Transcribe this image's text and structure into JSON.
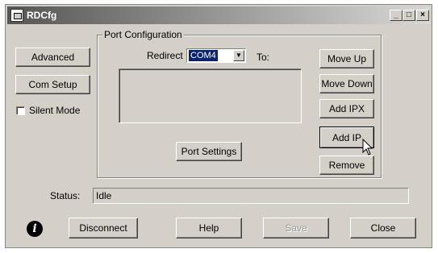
{
  "window": {
    "title": "RDCfg",
    "minimize": "_",
    "maximize": "□",
    "close": "×"
  },
  "left_panel": {
    "advanced_label": "Advanced",
    "com_setup_label": "Com Setup",
    "silent_mode_label": "Silent Mode"
  },
  "port_config": {
    "group_label": "Port Configuration",
    "redirect_label": "Redirect",
    "redirect_value": "COM4",
    "to_label": "To:",
    "port_settings_label": "Port Settings"
  },
  "right_buttons": {
    "move_up": "Move Up",
    "move_down": "Move Down",
    "add_ipx": "Add IPX",
    "add_ip": "Add IP",
    "remove": "Remove"
  },
  "status": {
    "label": "Status:",
    "value": "Idle"
  },
  "bottom_buttons": {
    "disconnect": "Disconnect",
    "help": "Help",
    "save": "Save",
    "close": "Close"
  },
  "icons": {
    "app": "app-icon",
    "info": "info-icon",
    "dropdown": "chevron-down-icon",
    "cursor": "mouse-pointer-icon"
  }
}
